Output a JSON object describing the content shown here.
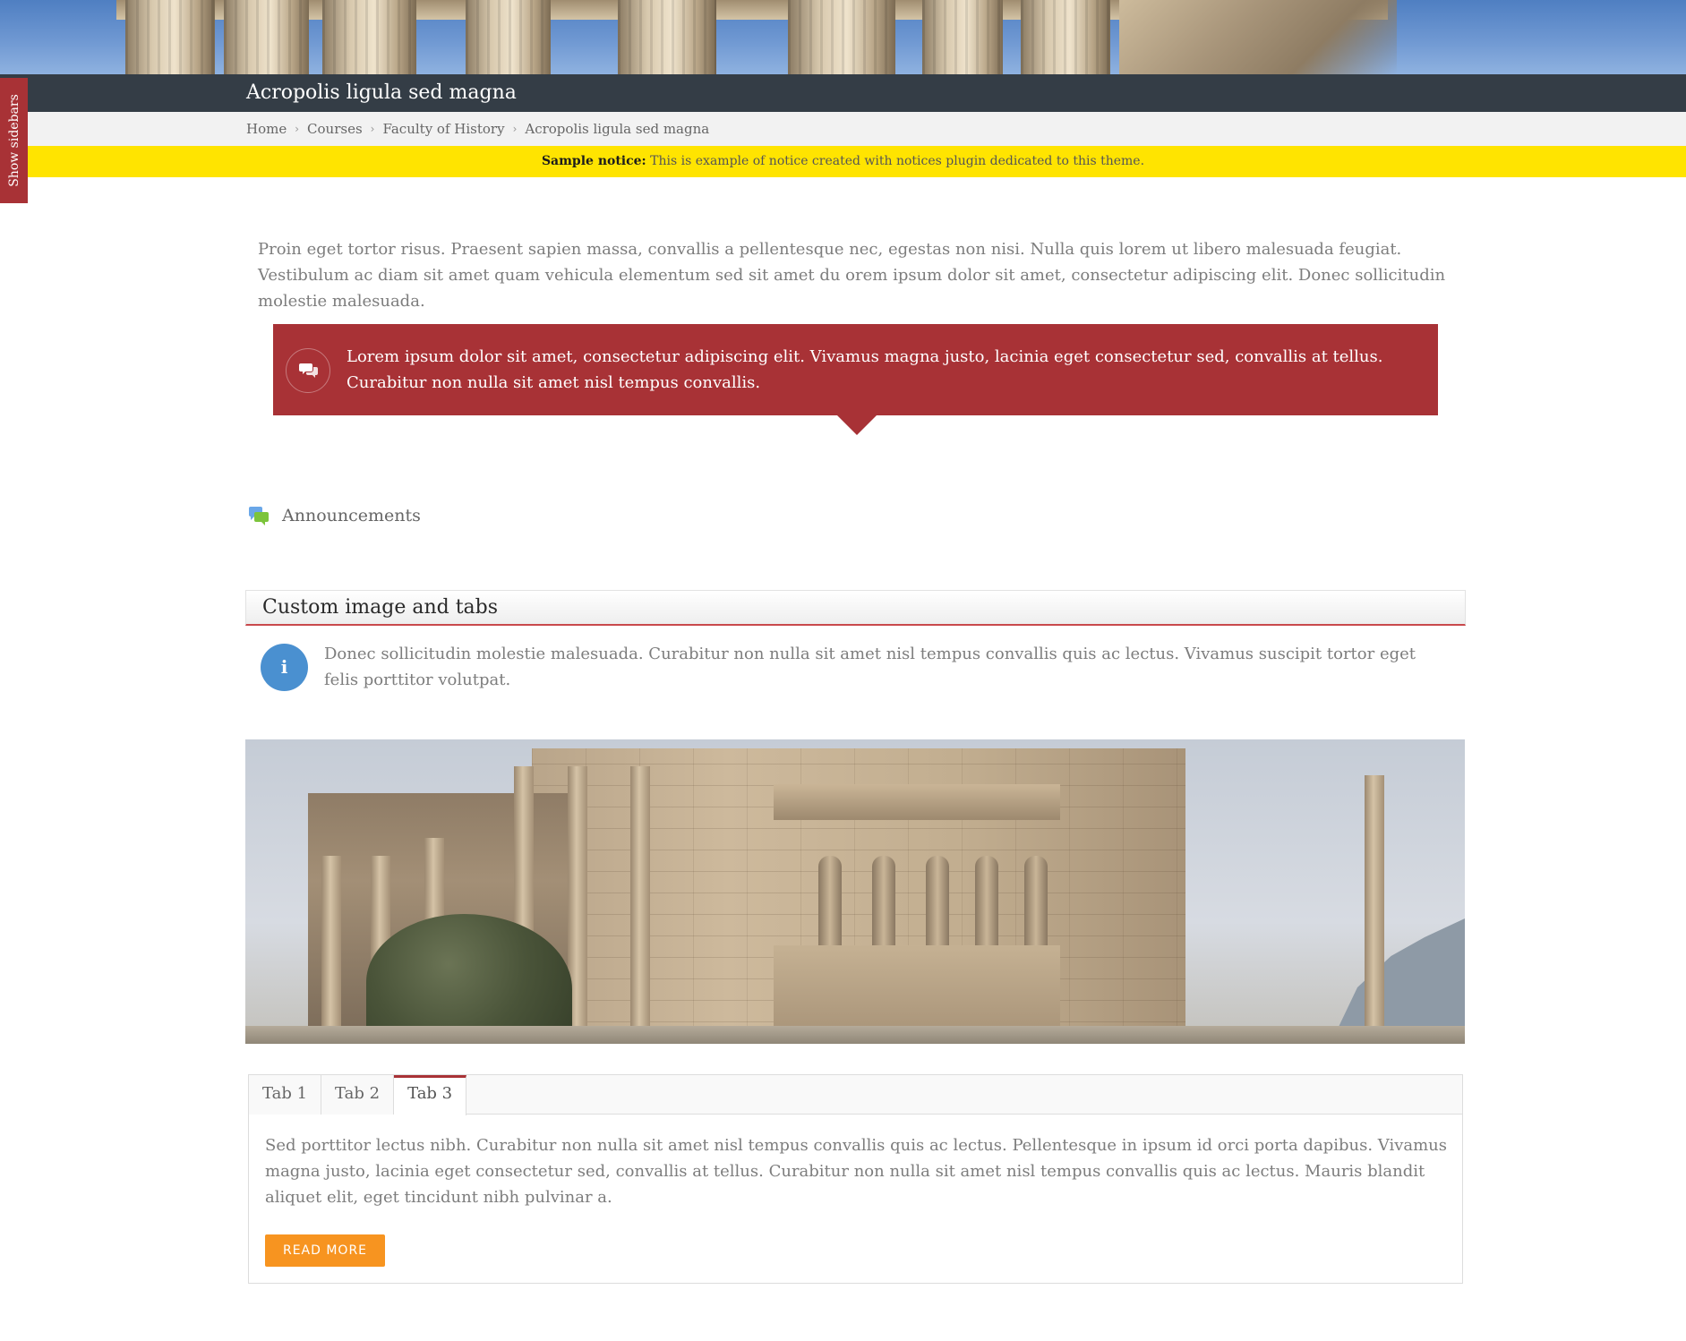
{
  "header": {
    "title": "Acropolis ligula sed magna"
  },
  "breadcrumb": {
    "items": [
      "Home",
      "Courses",
      "Faculty of History",
      "Acropolis ligula sed magna"
    ]
  },
  "notice": {
    "label": "Sample notice:",
    "text": " This is example of notice created with notices plugin dedicated to this theme."
  },
  "sidebar_toggle": {
    "label": "Show sidebars"
  },
  "intro": {
    "text": "Proin eget tortor risus. Praesent sapien massa, convallis a pellentesque nec, egestas non nisi. Nulla quis lorem ut libero malesuada feugiat. Vestibulum ac diam sit amet quam vehicula elementum sed sit amet du orem ipsum dolor sit amet, consectetur adipiscing elit. Donec sollicitudin molestie malesuada."
  },
  "quote": {
    "text": "Lorem ipsum dolor sit amet, consectetur adipiscing elit. Vivamus magna justo, lacinia eget consectetur sed, convallis at tellus. Curabitur non nulla sit amet nisl tempus convallis."
  },
  "announcements": {
    "label": "Announcements"
  },
  "section": {
    "title": "Custom image and tabs",
    "info_text": "Donec sollicitudin molestie malesuada. Curabitur non nulla sit amet nisl tempus convallis quis ac lectus. Vivamus suscipit tortor eget felis porttitor volutpat."
  },
  "tabs": {
    "items": [
      "Tab 1",
      "Tab 2",
      "Tab 3"
    ],
    "active": "Tab 3",
    "content": "Sed porttitor lectus nibh. Curabitur non nulla sit amet nisl tempus convallis quis ac lectus. Pellentesque in ipsum id orci porta dapibus. Vivamus magna justo, lacinia eget consectetur sed, convallis at tellus. Curabitur non nulla sit amet nisl tempus convallis quis ac lectus. Mauris blandit aliquet elit, eget tincidunt nibh pulvinar a.",
    "button_label": "READ MORE"
  },
  "colors": {
    "title_bar": "#343d46",
    "accent_red": "#a83236",
    "notice_yellow": "#ffe400",
    "info_blue": "#4a90d0",
    "button_orange": "#f79420"
  },
  "icons": {
    "quote": "comments-icon",
    "announcements": "forum-icon",
    "info": "info-icon",
    "breadcrumb_separator": "chevron-right-icon"
  }
}
